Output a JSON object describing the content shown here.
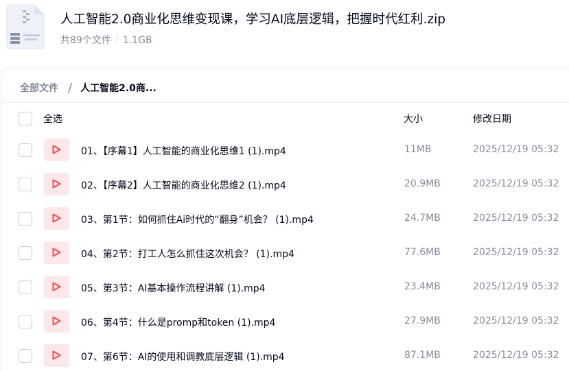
{
  "archive": {
    "title": "人工智能2.0商业化思维变现课，学习AI底层逻辑，把握时代红利.zip",
    "file_count": "共89个文件",
    "size": "1.1GB",
    "icon": "zip-file-icon"
  },
  "breadcrumb": {
    "root": "全部文件",
    "separator": "/",
    "current": "人工智能2.0商..."
  },
  "columns": {
    "select_all": "全选",
    "size": "大小",
    "modified": "修改日期"
  },
  "files": [
    {
      "name": "01、【序幕1】人工智能的商业化思维1 (1).mp4",
      "size": "11MB",
      "modified": "2025/12/19 05:32",
      "icon": "video-play-icon"
    },
    {
      "name": "02、【序幕2】人工智能的商业化思维2 (1).mp4",
      "size": "20.9MB",
      "modified": "2025/12/19 05:32",
      "icon": "video-play-icon"
    },
    {
      "name": "03、第1节：如何抓住Ai时代的“翻身”机会？ (1).mp4",
      "size": "24.7MB",
      "modified": "2025/12/19 05:32",
      "icon": "video-play-icon"
    },
    {
      "name": "04、第2节：打工人怎么抓住这次机会？ (1).mp4",
      "size": "77.6MB",
      "modified": "2025/12/19 05:32",
      "icon": "video-play-icon"
    },
    {
      "name": "05、第3节：AI基本操作流程讲解 (1).mp4",
      "size": "23.4MB",
      "modified": "2025/12/19 05:32",
      "icon": "video-play-icon"
    },
    {
      "name": "06、第4节：什么是promp和token (1).mp4",
      "size": "27.9MB",
      "modified": "2025/12/19 05:32",
      "icon": "video-play-icon"
    },
    {
      "name": "07、第6节：AI的使用和调教底层逻辑 (1).mp4",
      "size": "87.1MB",
      "modified": "2025/12/19 05:32",
      "icon": "video-play-icon"
    }
  ],
  "colors": {
    "text_primary": "#03081a",
    "text_secondary": "#878c9c",
    "video_icon_bg": "#fde8e9",
    "video_icon_fg": "#f2575d"
  }
}
